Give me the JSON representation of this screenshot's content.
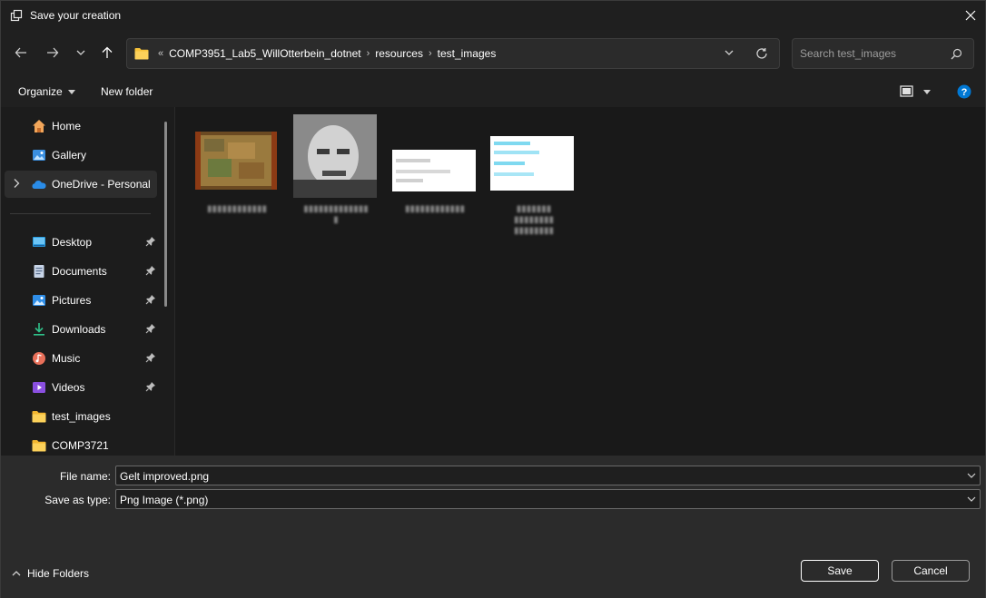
{
  "window": {
    "title": "Save your creation"
  },
  "address": {
    "overflow": "«",
    "crumbs": [
      "COMP3951_Lab5_WillOtterbein_dotnet",
      "resources",
      "test_images"
    ]
  },
  "search": {
    "placeholder": "Search test_images"
  },
  "commandbar": {
    "organize": "Organize",
    "new_folder": "New folder"
  },
  "sidebar": {
    "items": [
      {
        "label": "Home",
        "icon": "home-icon"
      },
      {
        "label": "Gallery",
        "icon": "gallery-icon"
      },
      {
        "label": "OneDrive - Personal",
        "icon": "onedrive-icon",
        "selected": true
      },
      {
        "label": "Desktop",
        "icon": "desktop-icon",
        "pinned": true
      },
      {
        "label": "Documents",
        "icon": "documents-icon",
        "pinned": true
      },
      {
        "label": "Pictures",
        "icon": "pictures-icon",
        "pinned": true
      },
      {
        "label": "Downloads",
        "icon": "downloads-icon",
        "pinned": true
      },
      {
        "label": "Music",
        "icon": "music-icon",
        "pinned": true
      },
      {
        "label": "Videos",
        "icon": "videos-icon",
        "pinned": true
      },
      {
        "label": "test_images",
        "icon": "folder-icon"
      },
      {
        "label": "COMP3721",
        "icon": "folder-icon"
      }
    ]
  },
  "files": [
    {
      "thumbnail": "map-thumbnail"
    },
    {
      "thumbnail": "portrait-thumbnail"
    },
    {
      "thumbnail": "text-thumbnail"
    },
    {
      "thumbnail": "text-cyan-thumbnail"
    }
  ],
  "form": {
    "file_name_label": "File name:",
    "file_name_value": "Gelt improved.png",
    "save_type_label": "Save as type:",
    "save_type_value": "Png Image (*.png)"
  },
  "footer": {
    "hide_folders": "Hide Folders",
    "save": "Save",
    "cancel": "Cancel"
  },
  "colors": {
    "accent": "#0078d4",
    "folder": "#f8c33a",
    "background": "#202020",
    "panel": "#2b2b2b"
  }
}
